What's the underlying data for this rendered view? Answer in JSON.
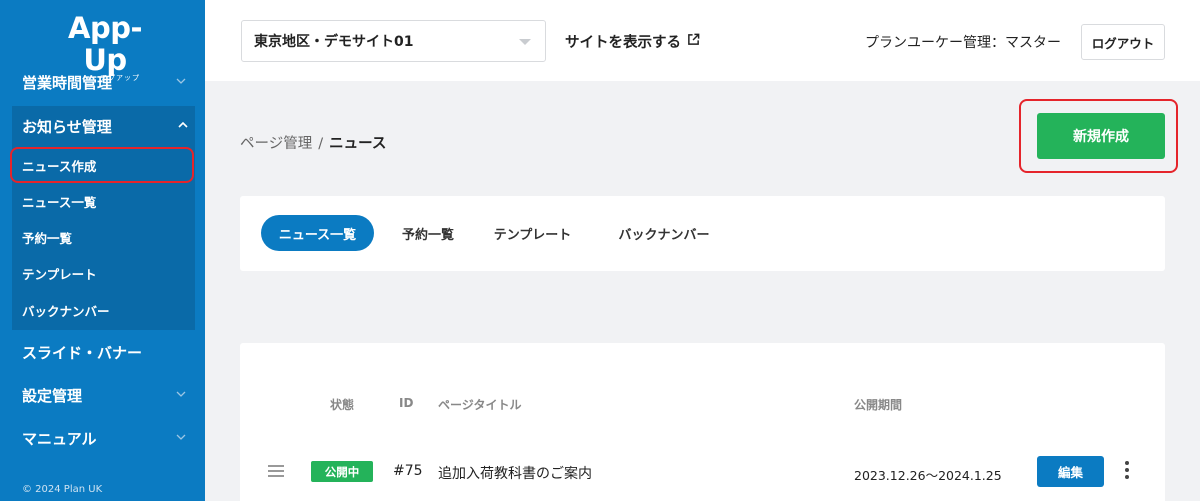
{
  "app": {
    "logo_text": "App-Up",
    "logo_sub": "アプアップ"
  },
  "sidebar": {
    "items": [
      {
        "label": "営業時間管理"
      },
      {
        "label": "お知らせ管理"
      },
      {
        "label": "スライド・バナー"
      },
      {
        "label": "設定管理"
      },
      {
        "label": "マニュアル"
      }
    ],
    "submenu": [
      {
        "label": "ニュース作成"
      },
      {
        "label": "ニュース一覧"
      },
      {
        "label": "予約一覧"
      },
      {
        "label": "テンプレート"
      },
      {
        "label": "バックナンバー"
      }
    ],
    "copyright": "© 2024 Plan UK"
  },
  "header": {
    "site_select_value": "東京地区・デモサイト01",
    "view_site_label": "サイトを表示する",
    "user_text": "プランユーケー管理：マスター",
    "logout_label": "ログアウト"
  },
  "breadcrumb": {
    "parent": "ページ管理",
    "separator": "/",
    "current": "ニュース"
  },
  "actions": {
    "new_label": "新規作成"
  },
  "tabs": [
    {
      "label": "ニュース一覧"
    },
    {
      "label": "予約一覧"
    },
    {
      "label": "テンプレート"
    },
    {
      "label": "バックナンバー"
    }
  ],
  "table": {
    "headers": {
      "status": "状態",
      "id": "ID",
      "title": "ページタイトル",
      "period": "公開期間"
    },
    "rows": [
      {
        "status": "公開中",
        "id": "#75",
        "title": "追加入荷教科書のご案内",
        "period": "2023.12.26〜2024.1.25",
        "edit_label": "編集"
      }
    ]
  },
  "colors": {
    "sidebar": "#0b7bc2",
    "primary_green": "#24b35a",
    "highlight_red": "#e5242b"
  }
}
